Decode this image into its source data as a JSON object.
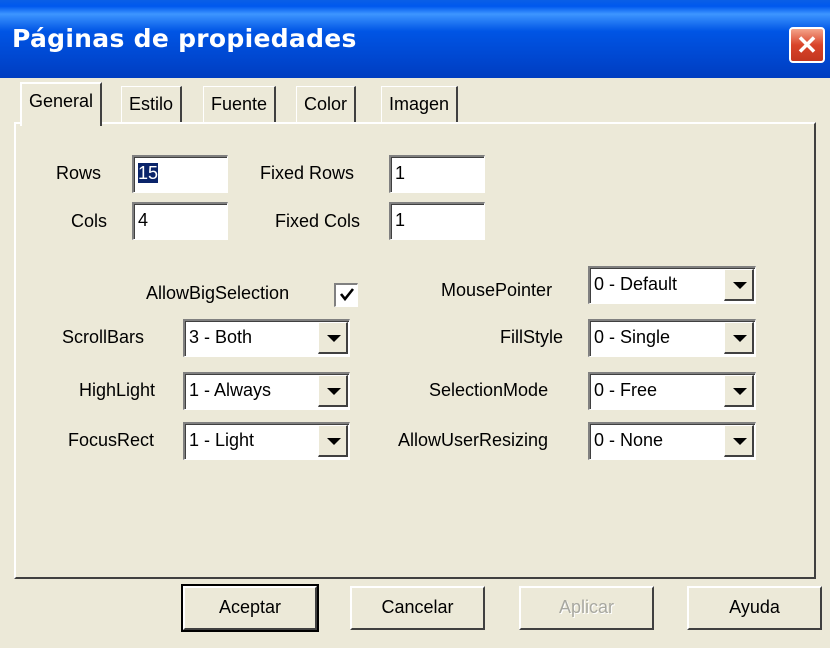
{
  "window": {
    "title": "Páginas de propiedades",
    "close_icon": "close-icon"
  },
  "tabs": [
    "General",
    "Estilo",
    "Fuente",
    "Color",
    "Imagen"
  ],
  "active_tab": "General",
  "fields": {
    "rows": {
      "label": "Rows",
      "value": "15"
    },
    "cols": {
      "label": "Cols",
      "value": "4"
    },
    "fixed_rows": {
      "label": "Fixed Rows",
      "value": "1"
    },
    "fixed_cols": {
      "label": "Fixed Cols",
      "value": "1"
    }
  },
  "allow_big_selection": {
    "label": "AllowBigSelection",
    "checked": true
  },
  "left_combos": {
    "scrollbars": {
      "label": "ScrollBars",
      "value": "3 - Both"
    },
    "highlight": {
      "label": "HighLight",
      "value": "1 - Always"
    },
    "focusrect": {
      "label": "FocusRect",
      "value": "1 - Light"
    }
  },
  "right_combos": {
    "mousepointer": {
      "label": "MousePointer",
      "value": "0 - Default"
    },
    "fillstyle": {
      "label": "FillStyle",
      "value": "0 - Single"
    },
    "selectionmode": {
      "label": "SelectionMode",
      "value": "0 - Free"
    },
    "allowuserresizing": {
      "label": "AllowUserResizing",
      "value": "0 - None"
    }
  },
  "buttons": {
    "ok": "Aceptar",
    "cancel": "Cancelar",
    "apply": "Aplicar",
    "help": "Ayuda"
  },
  "colors": {
    "titlebar": "#0054E3",
    "dialog_bg": "#ECE9D8",
    "close": "#D9442A",
    "selection": "#0A246A"
  }
}
